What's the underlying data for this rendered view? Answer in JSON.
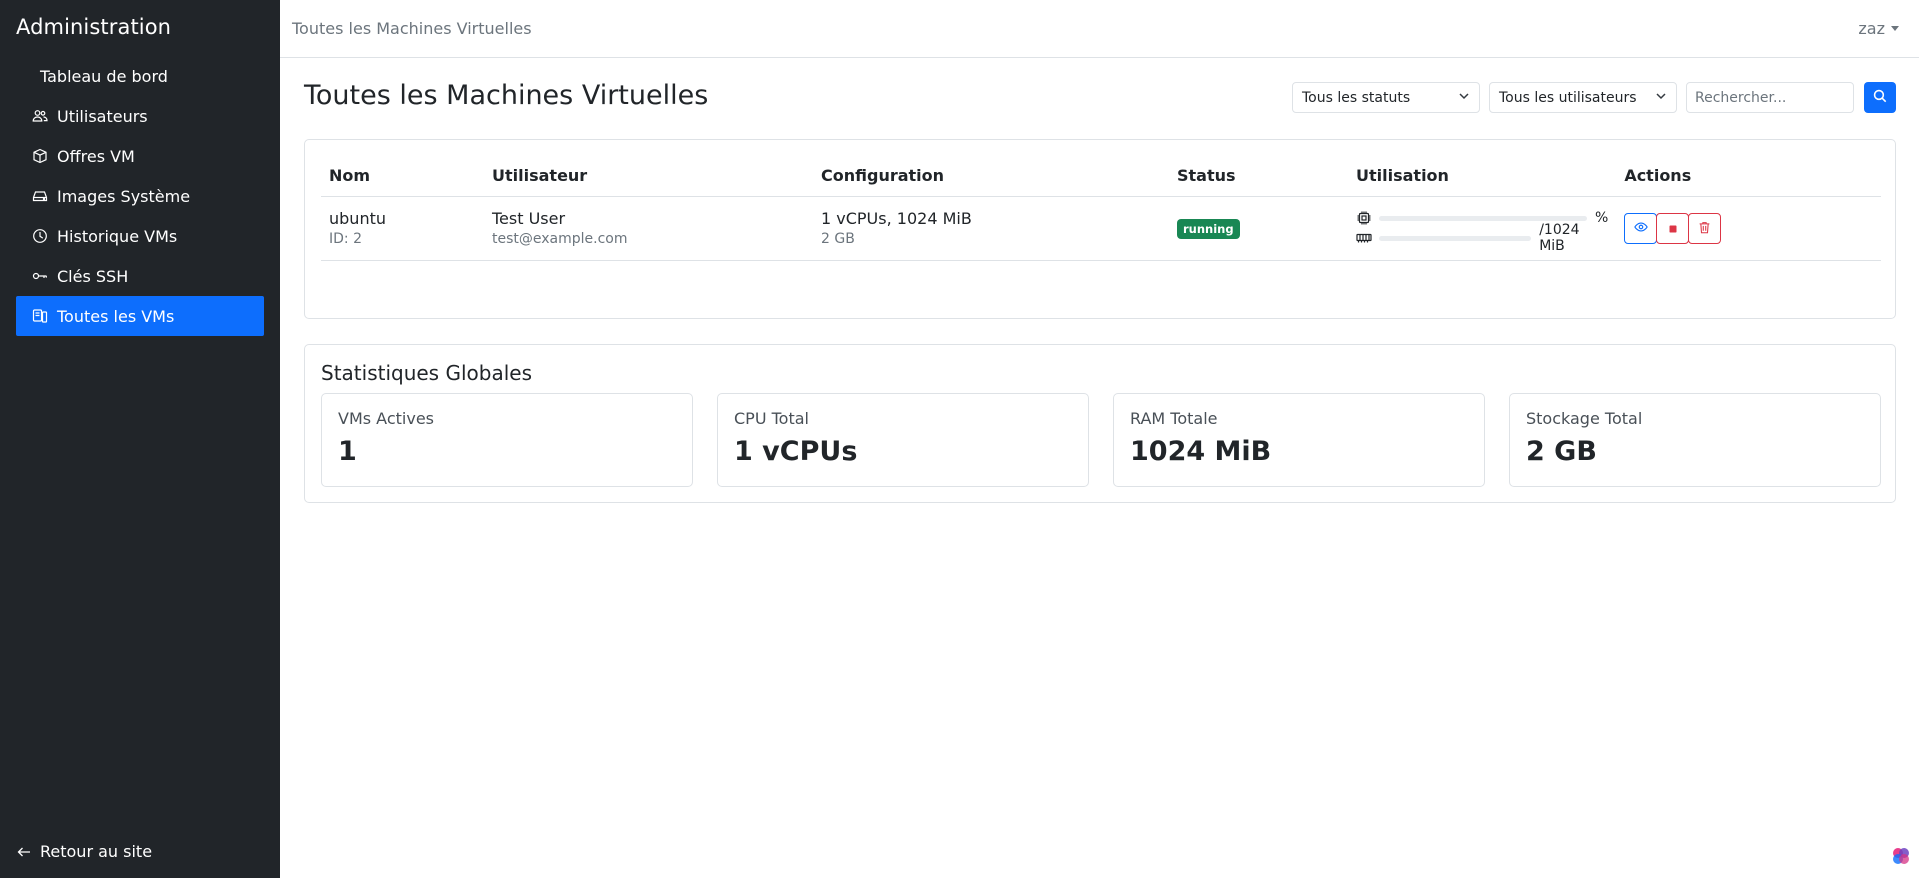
{
  "sidebar": {
    "title": "Administration",
    "items": [
      {
        "label": "Tableau de bord",
        "icon": "none"
      },
      {
        "label": "Utilisateurs",
        "icon": "people-icon"
      },
      {
        "label": "Offres VM",
        "icon": "box-icon"
      },
      {
        "label": "Images Système",
        "icon": "hdd-icon"
      },
      {
        "label": "Historique VMs",
        "icon": "clock-icon"
      },
      {
        "label": "Clés SSH",
        "icon": "key-icon"
      },
      {
        "label": "Toutes les VMs",
        "icon": "vms-icon",
        "active": true
      }
    ],
    "back_label": "Retour au site"
  },
  "topbar": {
    "title": "Toutes les Machines Virtuelles",
    "user": "zaz"
  },
  "main": {
    "page_title": "Toutes les Machines Virtuelles",
    "filters": {
      "status_selected": "Tous les statuts",
      "user_selected": "Tous les utilisateurs",
      "search_placeholder": "Rechercher..."
    },
    "table": {
      "headers": [
        "Nom",
        "Utilisateur",
        "Configuration",
        "Status",
        "Utilisation",
        "Actions"
      ],
      "rows": [
        {
          "name": "ubuntu",
          "id_label": "ID: 2",
          "user_name": "Test User",
          "user_email": "test@example.com",
          "config": "1 vCPUs, 1024 MiB",
          "storage": "2 GB",
          "status": "running",
          "cpu_suffix": "%",
          "cpu_fraction": 0,
          "ram_suffix": "/1024 MiB",
          "ram_fraction": 0
        }
      ]
    },
    "stats": {
      "title": "Statistiques Globales",
      "boxes": [
        {
          "label": "VMs Actives",
          "value": "1"
        },
        {
          "label": "CPU Total",
          "value": "1 vCPUs"
        },
        {
          "label": "RAM Totale",
          "value": "1024 MiB"
        },
        {
          "label": "Stockage Total",
          "value": "2 GB"
        }
      ]
    }
  },
  "colors": {
    "sidebar_bg": "#212529",
    "accent": "#0d6efd",
    "success": "#198754",
    "danger": "#dc3545"
  }
}
